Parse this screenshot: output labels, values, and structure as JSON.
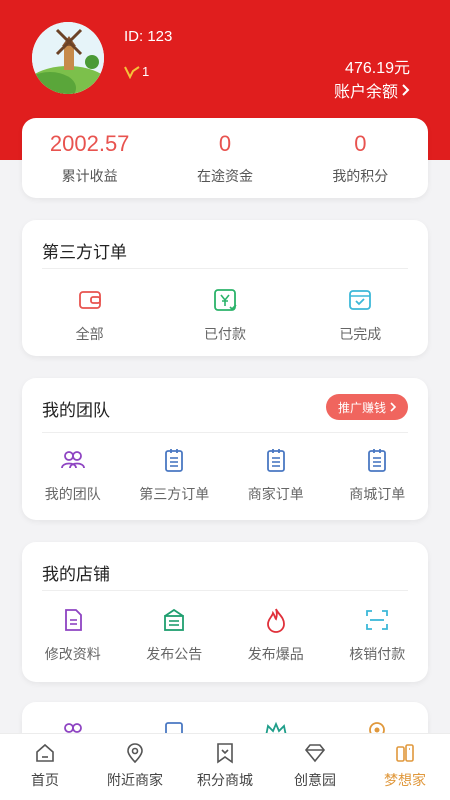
{
  "header": {
    "user_id": "ID: 123",
    "level": "1",
    "balance": "476.19元",
    "balance_label": "账户余额"
  },
  "stats": [
    {
      "value": "2002.57",
      "label": "累计收益"
    },
    {
      "value": "0",
      "label": "在途资金"
    },
    {
      "value": "0",
      "label": "我的积分"
    }
  ],
  "third_party_orders": {
    "title": "第三方订单",
    "items": [
      {
        "label": "全部",
        "icon": "wallet-icon",
        "color": "#e8534f"
      },
      {
        "label": "已付款",
        "icon": "yen-check-icon",
        "color": "#2bb36a"
      },
      {
        "label": "已完成",
        "icon": "check-card-icon",
        "color": "#3cb8d8"
      }
    ]
  },
  "my_team": {
    "title": "我的团队",
    "promo_label": "推广赚钱",
    "items": [
      {
        "label": "我的团队",
        "icon": "team-icon",
        "color": "#8e44c2"
      },
      {
        "label": "第三方订单",
        "icon": "clipboard-icon",
        "color": "#4a78c2"
      },
      {
        "label": "商家订单",
        "icon": "clipboard-icon",
        "color": "#4a78c2"
      },
      {
        "label": "商城订单",
        "icon": "clipboard-icon",
        "color": "#4a78c2"
      }
    ]
  },
  "my_shop": {
    "title": "我的店铺",
    "items": [
      {
        "label": "修改资料",
        "icon": "document-icon",
        "color": "#8e44c2"
      },
      {
        "label": "发布公告",
        "icon": "announcement-icon",
        "color": "#1f9e6f"
      },
      {
        "label": "发布爆品",
        "icon": "fire-icon",
        "color": "#e0303a"
      },
      {
        "label": "核销付款",
        "icon": "scan-icon",
        "color": "#3cb8d8"
      }
    ]
  },
  "tabbar": [
    {
      "label": "首页",
      "icon": "home-icon",
      "active": false
    },
    {
      "label": "附近商家",
      "icon": "location-icon",
      "active": false
    },
    {
      "label": "积分商城",
      "icon": "bookmark-icon",
      "active": false
    },
    {
      "label": "创意园",
      "icon": "diamond-icon",
      "active": false
    },
    {
      "label": "梦想家",
      "icon": "profile-card-icon",
      "active": true
    }
  ],
  "colors": {
    "brand": "#e01e1e",
    "stat_value": "#e8534f",
    "promo": "#f0655e",
    "active_tab": "#e0983c"
  }
}
